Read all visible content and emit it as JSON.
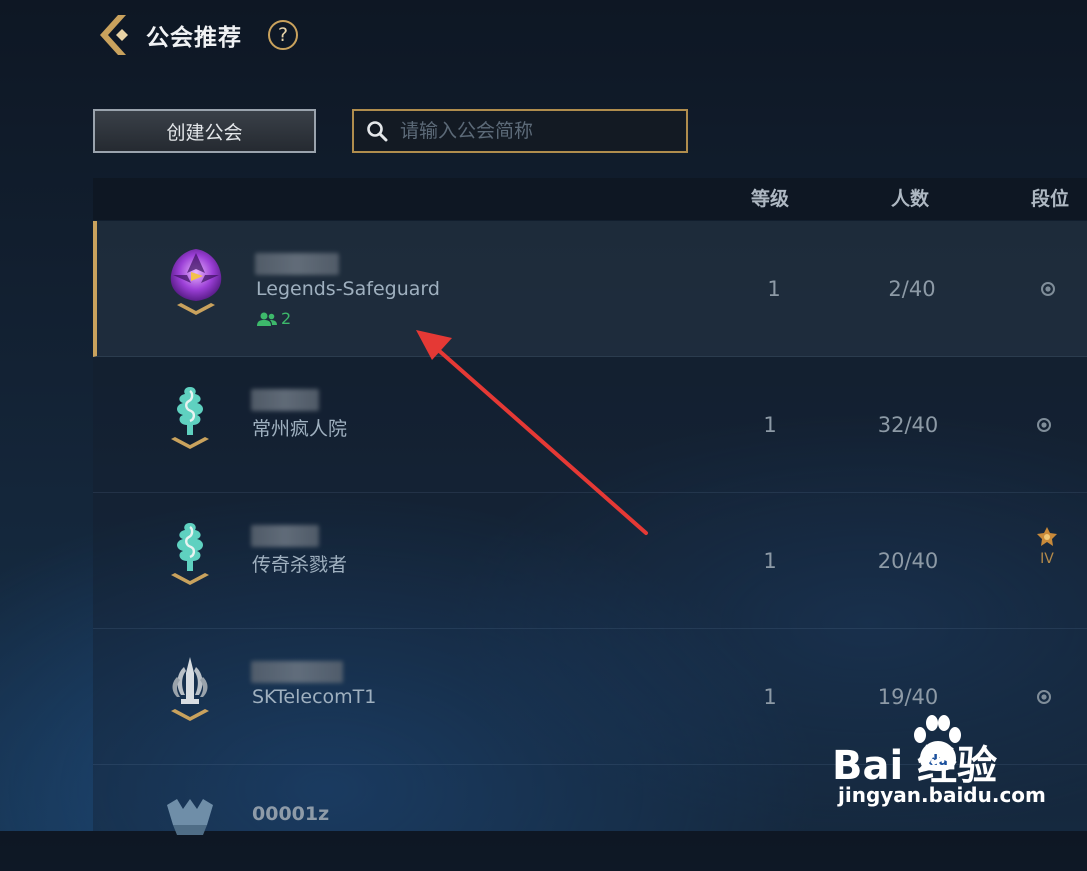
{
  "header": {
    "title": "公会推荐",
    "help_label": "?"
  },
  "toolbar": {
    "create_label": "创建公会"
  },
  "search": {
    "placeholder": "请输入公会简称",
    "value": ""
  },
  "table": {
    "columns": [
      "等级",
      "人数",
      "段位"
    ],
    "rows": [
      {
        "name": "Legends-Safeguard",
        "level": "1",
        "members": "2/40",
        "online": "2",
        "selected": true,
        "rank_tier": ""
      },
      {
        "name": "常州疯人院",
        "level": "1",
        "members": "32/40",
        "online": "",
        "selected": false,
        "rank_tier": ""
      },
      {
        "name": "传奇杀戮者",
        "level": "1",
        "members": "20/40",
        "online": "",
        "selected": false,
        "rank_tier": "IV"
      },
      {
        "name": "SKTelecomT1",
        "level": "1",
        "members": "19/40",
        "online": "",
        "selected": false,
        "rank_tier": ""
      },
      {
        "name": "00001z",
        "level": "",
        "members": "",
        "online": "",
        "selected": false,
        "rank_tier": ""
      }
    ]
  },
  "watermark": {
    "main": "Bai  经验",
    "sub": "jingyan.baidu.com"
  },
  "colors": {
    "accent_gold": "#c9a25d",
    "online_green": "#3db96b",
    "annotation_red": "#e53935"
  },
  "icons": [
    "back-chevron-icon",
    "help-icon",
    "search-icon",
    "guild-emblem-icon",
    "members-icon",
    "rank-icon",
    "paw-icon"
  ]
}
